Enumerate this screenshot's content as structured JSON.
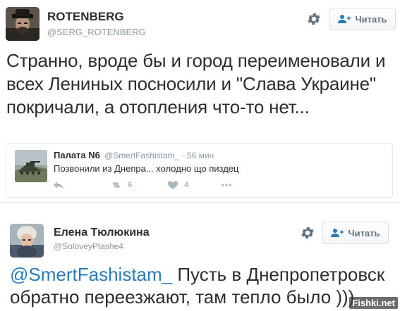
{
  "tweet": {
    "author_name": "ROTENBERG",
    "author_handle": "@SERG_ROTENBERG",
    "follow_label": "Читать",
    "text": "Странно, вроде бы и город переименовали и всех Лениных посносили и \"Слава Украине\" покричали, а отопления что-то нет..."
  },
  "quoted": {
    "author_name": "Палата N6",
    "author_handle": "@SmertFashistam_",
    "time": "· 56 мин",
    "text": "Позвонили из Днепра... холодно що пиздец",
    "retweet_count": "6",
    "like_count": "4"
  },
  "reply": {
    "author_name": "Елена Тюлюкина",
    "author_handle": "@SoloveyPtashe4",
    "follow_label": "Читать",
    "mention": "@SmertFashistam_",
    "text": " Пусть в Днепропетровск обратно переезжают, там тепло было )))"
  },
  "watermark": "Fishki.net",
  "colors": {
    "link": "#2b7bb9",
    "muted": "#8899a6",
    "text": "#292f33"
  },
  "icons": [
    "gear-icon",
    "follow-person-icon",
    "reply-icon",
    "retweet-icon",
    "like-icon",
    "more-icon"
  ]
}
